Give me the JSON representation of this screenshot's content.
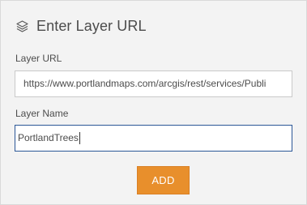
{
  "header": {
    "title": "Enter Layer URL",
    "icon": "layers-icon"
  },
  "form": {
    "url_label": "Layer URL",
    "url_value": "https://www.portlandmaps.com/arcgis/rest/services/Publi",
    "name_label": "Layer Name",
    "name_value": "PortlandTrees"
  },
  "actions": {
    "add_label": "ADD"
  },
  "colors": {
    "accent_button": "#e88f2c",
    "focus_border": "#2b5797",
    "panel_background": "#f3f3f3"
  }
}
